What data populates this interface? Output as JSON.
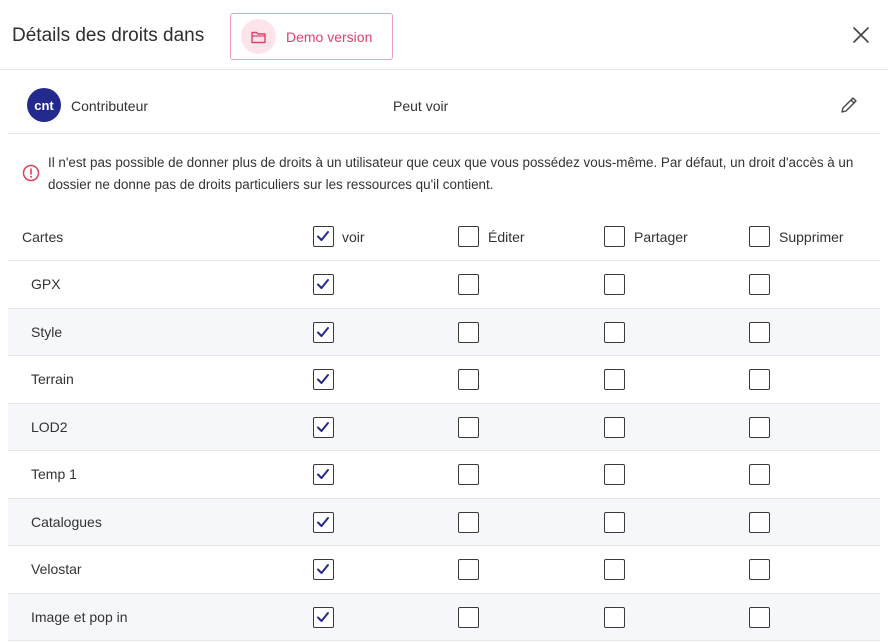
{
  "header": {
    "title": "Détails des droits dans",
    "demo_label": "Demo version"
  },
  "role": {
    "avatar_text": "cnt",
    "name": "Contributeur",
    "access": "Peut voir"
  },
  "warning": {
    "text": "Il n'est pas possible de donner plus de droits à un utilisateur que ceux que vous possédez vous-même. Par défaut, un droit d'accès à un dossier ne donne pas de droits particuliers sur les ressources qu'il contient."
  },
  "table": {
    "header_label": "Cartes",
    "columns": [
      "voir",
      "Éditer",
      "Partager",
      "Supprimer"
    ],
    "header_checked": [
      true,
      false,
      false,
      false
    ],
    "rows": [
      {
        "label": "GPX",
        "checked": [
          true,
          false,
          false,
          false
        ]
      },
      {
        "label": "Style",
        "checked": [
          true,
          false,
          false,
          false
        ]
      },
      {
        "label": "Terrain",
        "checked": [
          true,
          false,
          false,
          false
        ]
      },
      {
        "label": "LOD2",
        "checked": [
          true,
          false,
          false,
          false
        ]
      },
      {
        "label": "Temp 1",
        "checked": [
          true,
          false,
          false,
          false
        ]
      },
      {
        "label": "Catalogues",
        "checked": [
          true,
          false,
          false,
          false
        ]
      },
      {
        "label": "Velostar",
        "checked": [
          true,
          false,
          false,
          false
        ]
      },
      {
        "label": "Image et pop in",
        "checked": [
          true,
          false,
          false,
          false
        ]
      }
    ]
  },
  "colors": {
    "accent": "#232a8e",
    "demo": "#e0406a",
    "warning": "#e0405a"
  }
}
